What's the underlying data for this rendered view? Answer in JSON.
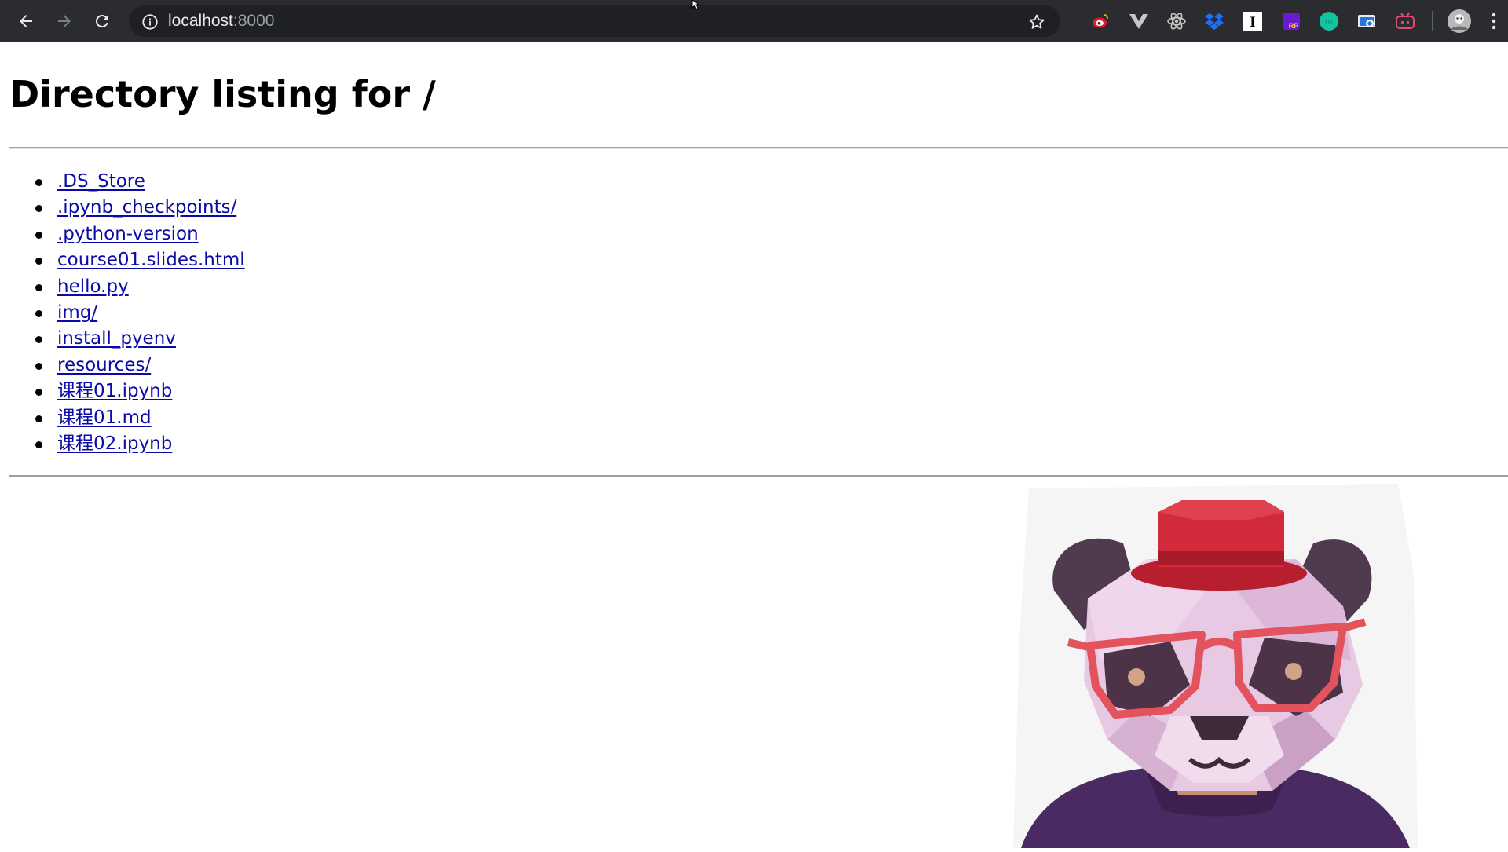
{
  "browser": {
    "url_host": "localhost",
    "url_port": ":8000",
    "extensions": [
      "weibo-icon",
      "vue-devtools-icon",
      "react-devtools-icon",
      "dropbox-icon",
      "instapaper-icon",
      "ratings-plus-icon",
      "green-circle-icon",
      "screenshot-icon",
      "bilibili-icon"
    ],
    "accent": "#8ab4f8"
  },
  "page": {
    "title": "Directory listing for /",
    "entries": [
      ".DS_Store",
      ".ipynb_checkpoints/",
      ".python-version",
      "course01.slides.html",
      "hello.py",
      "img/",
      "install_pyenv",
      "resources/",
      "课程01.ipynb",
      "课程01.md",
      "课程02.ipynb"
    ],
    "link_color": "#0a0aa8"
  }
}
